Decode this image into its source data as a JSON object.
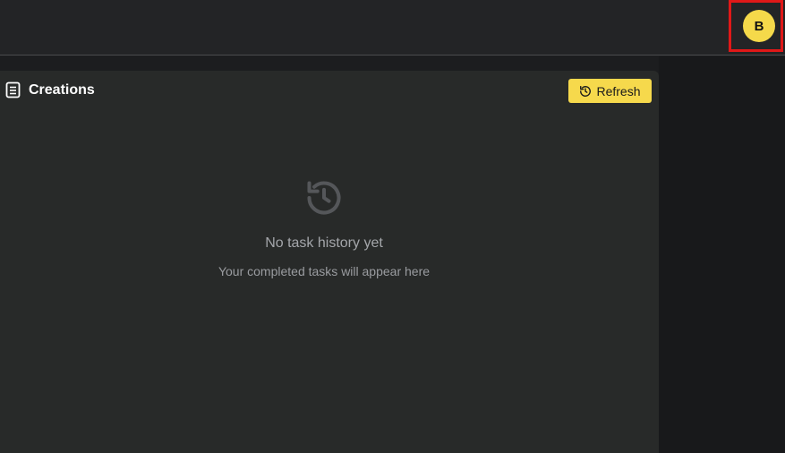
{
  "header": {
    "avatar_initial": "B"
  },
  "panel": {
    "title": "Creations",
    "refresh_label": "Refresh",
    "empty_title": "No task history yet",
    "empty_subtitle": "Your completed tasks will appear here"
  },
  "colors": {
    "accent": "#f6d94c",
    "annotation": "#e01818"
  }
}
